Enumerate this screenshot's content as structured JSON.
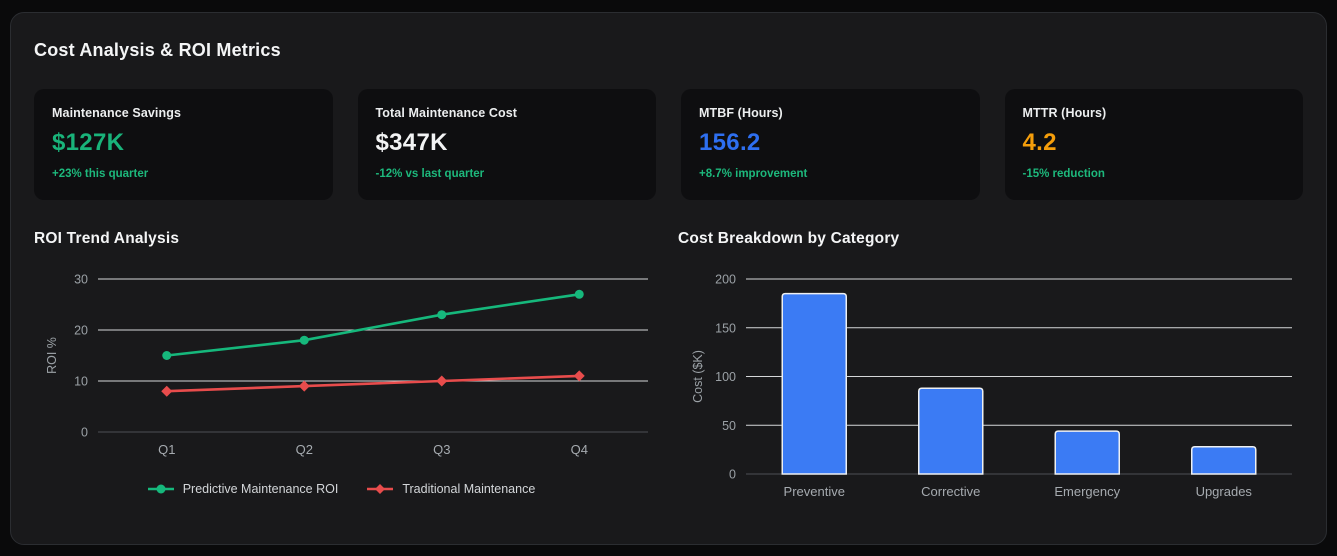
{
  "page_title": "Cost Analysis & ROI Metrics",
  "colors": {
    "page_bg": "#0a0a0b",
    "panel_bg": "#19191b",
    "panel_border": "#2b2d31",
    "card_bg": "#0e0e10",
    "title_text": "#f4f5f6",
    "tick_text": "#9ba1a6",
    "category_text": "#a6abb0",
    "legend_text": "#d3d6d9",
    "grid_line": "#d5d7d9",
    "axis_line": "#4d5055",
    "positive_green": "#1db87c",
    "value_green": "#19b37a",
    "value_blue": "#2e6ff0",
    "value_orange": "#f59e0b",
    "bar_blue": "#3b7bf4",
    "bar_border": "#eef0f2",
    "line_green": "#16b87c",
    "line_red": "#e84c4c"
  },
  "cards": [
    {
      "label": "Maintenance Savings",
      "value": "$127K",
      "value_color": "#19b37a",
      "sub": "+23% this quarter",
      "sub_color": "#1db87c"
    },
    {
      "label": "Total Maintenance Cost",
      "value": "$347K",
      "value_color": "#f2f3f4",
      "sub": "-12% vs last quarter",
      "sub_color": "#1db87c"
    },
    {
      "label": "MTBF (Hours)",
      "value": "156.2",
      "value_color": "#2e6ff0",
      "sub": "+8.7% improvement",
      "sub_color": "#1db87c"
    },
    {
      "label": "MTTR (Hours)",
      "value": "4.2",
      "value_color": "#f59e0b",
      "sub": "-15% reduction",
      "sub_color": "#1db87c"
    }
  ],
  "chart_data": [
    {
      "type": "line",
      "title": "ROI Trend Analysis",
      "categories": [
        "Q1",
        "Q2",
        "Q3",
        "Q4"
      ],
      "series": [
        {
          "name": "Predictive Maintenance ROI",
          "color": "#16b87c",
          "marker": "circle",
          "values": [
            15,
            18,
            23,
            27
          ]
        },
        {
          "name": "Traditional Maintenance",
          "color": "#e84c4c",
          "marker": "diamond",
          "values": [
            8,
            9,
            10,
            11
          ]
        }
      ],
      "xlabel": "",
      "ylabel": "ROI %",
      "ylim": [
        0,
        30
      ],
      "yticks": [
        0,
        10,
        20,
        30
      ],
      "grid": true,
      "legend_position": "bottom"
    },
    {
      "type": "bar",
      "title": "Cost Breakdown by Category",
      "categories": [
        "Preventive",
        "Corrective",
        "Emergency",
        "Upgrades"
      ],
      "values": [
        185,
        88,
        44,
        28
      ],
      "bar_color": "#3b7bf4",
      "bar_border_color": "#eef0f2",
      "xlabel": "",
      "ylabel": "Cost ($K)",
      "ylim": [
        0,
        200
      ],
      "yticks": [
        0,
        50,
        100,
        150,
        200
      ],
      "grid": true,
      "legend_position": "none"
    }
  ]
}
